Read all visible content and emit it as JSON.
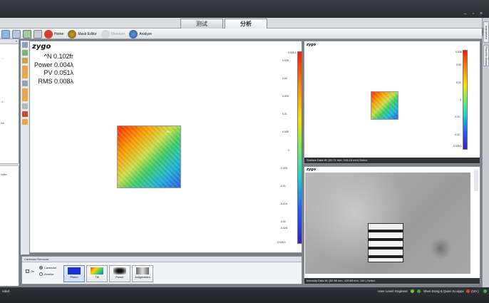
{
  "tabs": [
    {
      "label": "测试",
      "active": false
    },
    {
      "label": "分析",
      "active": true
    }
  ],
  "toolbar": {
    "home": "Home",
    "mask_editor": "Mask Editor",
    "measure": "Measure",
    "analyze": "Analyze"
  },
  "right_strip": {
    "tab1": "Instrument Status",
    "tab2": "Process Status"
  },
  "left_panel": {
    "line1": "....",
    "line2": "-1",
    "line3": "ern",
    "line4": "ristics"
  },
  "main_plot": {
    "logo": "zygo",
    "stats": [
      {
        "label": "^N",
        "value": "0.102fr"
      },
      {
        "label": "Power",
        "value": "0.004λ"
      },
      {
        "label": "PV",
        "value": "0.051λ"
      },
      {
        "label": "RMS",
        "value": "0.008λ"
      }
    ],
    "colorbar_ticks": [
      "0.026 λ",
      "0.025",
      "0.02",
      "0.015",
      "0.01",
      "0.005",
      "0",
      "-0.005",
      "-0.01",
      "-0.015",
      "-0.02",
      "-0.025",
      "-0.026 λ"
    ],
    "map_label": "15 λ"
  },
  "card_panel": {
    "title": "Cartesian Removal",
    "on_label": "On",
    "radio_cartesian": "Cartesian",
    "radio_zernike": "Zernike",
    "cards": [
      "Piston",
      "Tilt",
      "Power",
      "Astigmatism"
    ]
  },
  "surface_panel": {
    "logo": "zygo",
    "ticks": [
      "0.026 λ",
      "0.02",
      "0.01",
      "0",
      "-0.01",
      "-0.02",
      "-0.026 λ"
    ],
    "status": "Surface Data    W: (61.71 mm, 143.18 mm)    Select"
  },
  "intensity_panel": {
    "logo": "zygo",
    "status": "Intensity Data    W: (52.86 mm, 120.65 mm, 116 )    Select"
  },
  "statusbar": {
    "left": "nded",
    "user_level": "User Level: Engineer",
    "file": "Shen Dong & Quan Xu.appx",
    "count": "(10+)"
  },
  "colors": {
    "accent_orange": "#e7a64b",
    "status_dark": "#2f3236"
  }
}
